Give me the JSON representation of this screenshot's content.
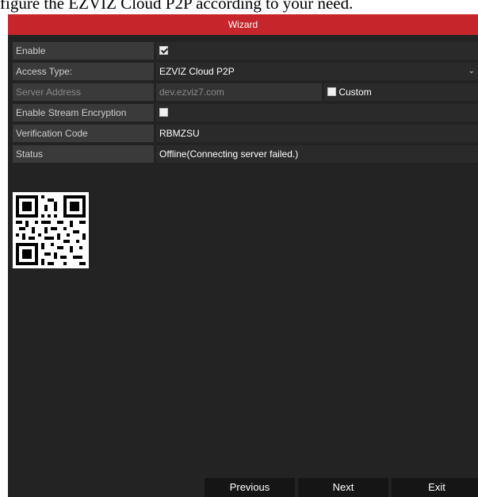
{
  "caption": "figure the EZVIZ Cloud P2P according to your need.",
  "window": {
    "title": "Wizard"
  },
  "form": {
    "enable": {
      "label": "Enable",
      "checked": true
    },
    "access_type": {
      "label": "Access Type:",
      "value": "EZVIZ Cloud P2P"
    },
    "server_address": {
      "label": "Server Address",
      "value": "dev.ezviz7.com",
      "custom_label": "Custom",
      "custom_checked": false
    },
    "stream_encryption": {
      "label": "Enable Stream Encryption",
      "checked": false
    },
    "verification_code": {
      "label": "Verification Code",
      "value": "RBMZSU"
    },
    "status": {
      "label": "Status",
      "value": "Offline(Connecting server failed.)"
    }
  },
  "buttons": {
    "previous": "Previous",
    "next": "Next",
    "exit": "Exit"
  },
  "colors": {
    "title_bar": "#c6262b",
    "background": "#232323",
    "label_bg": "#3a3a3a"
  }
}
